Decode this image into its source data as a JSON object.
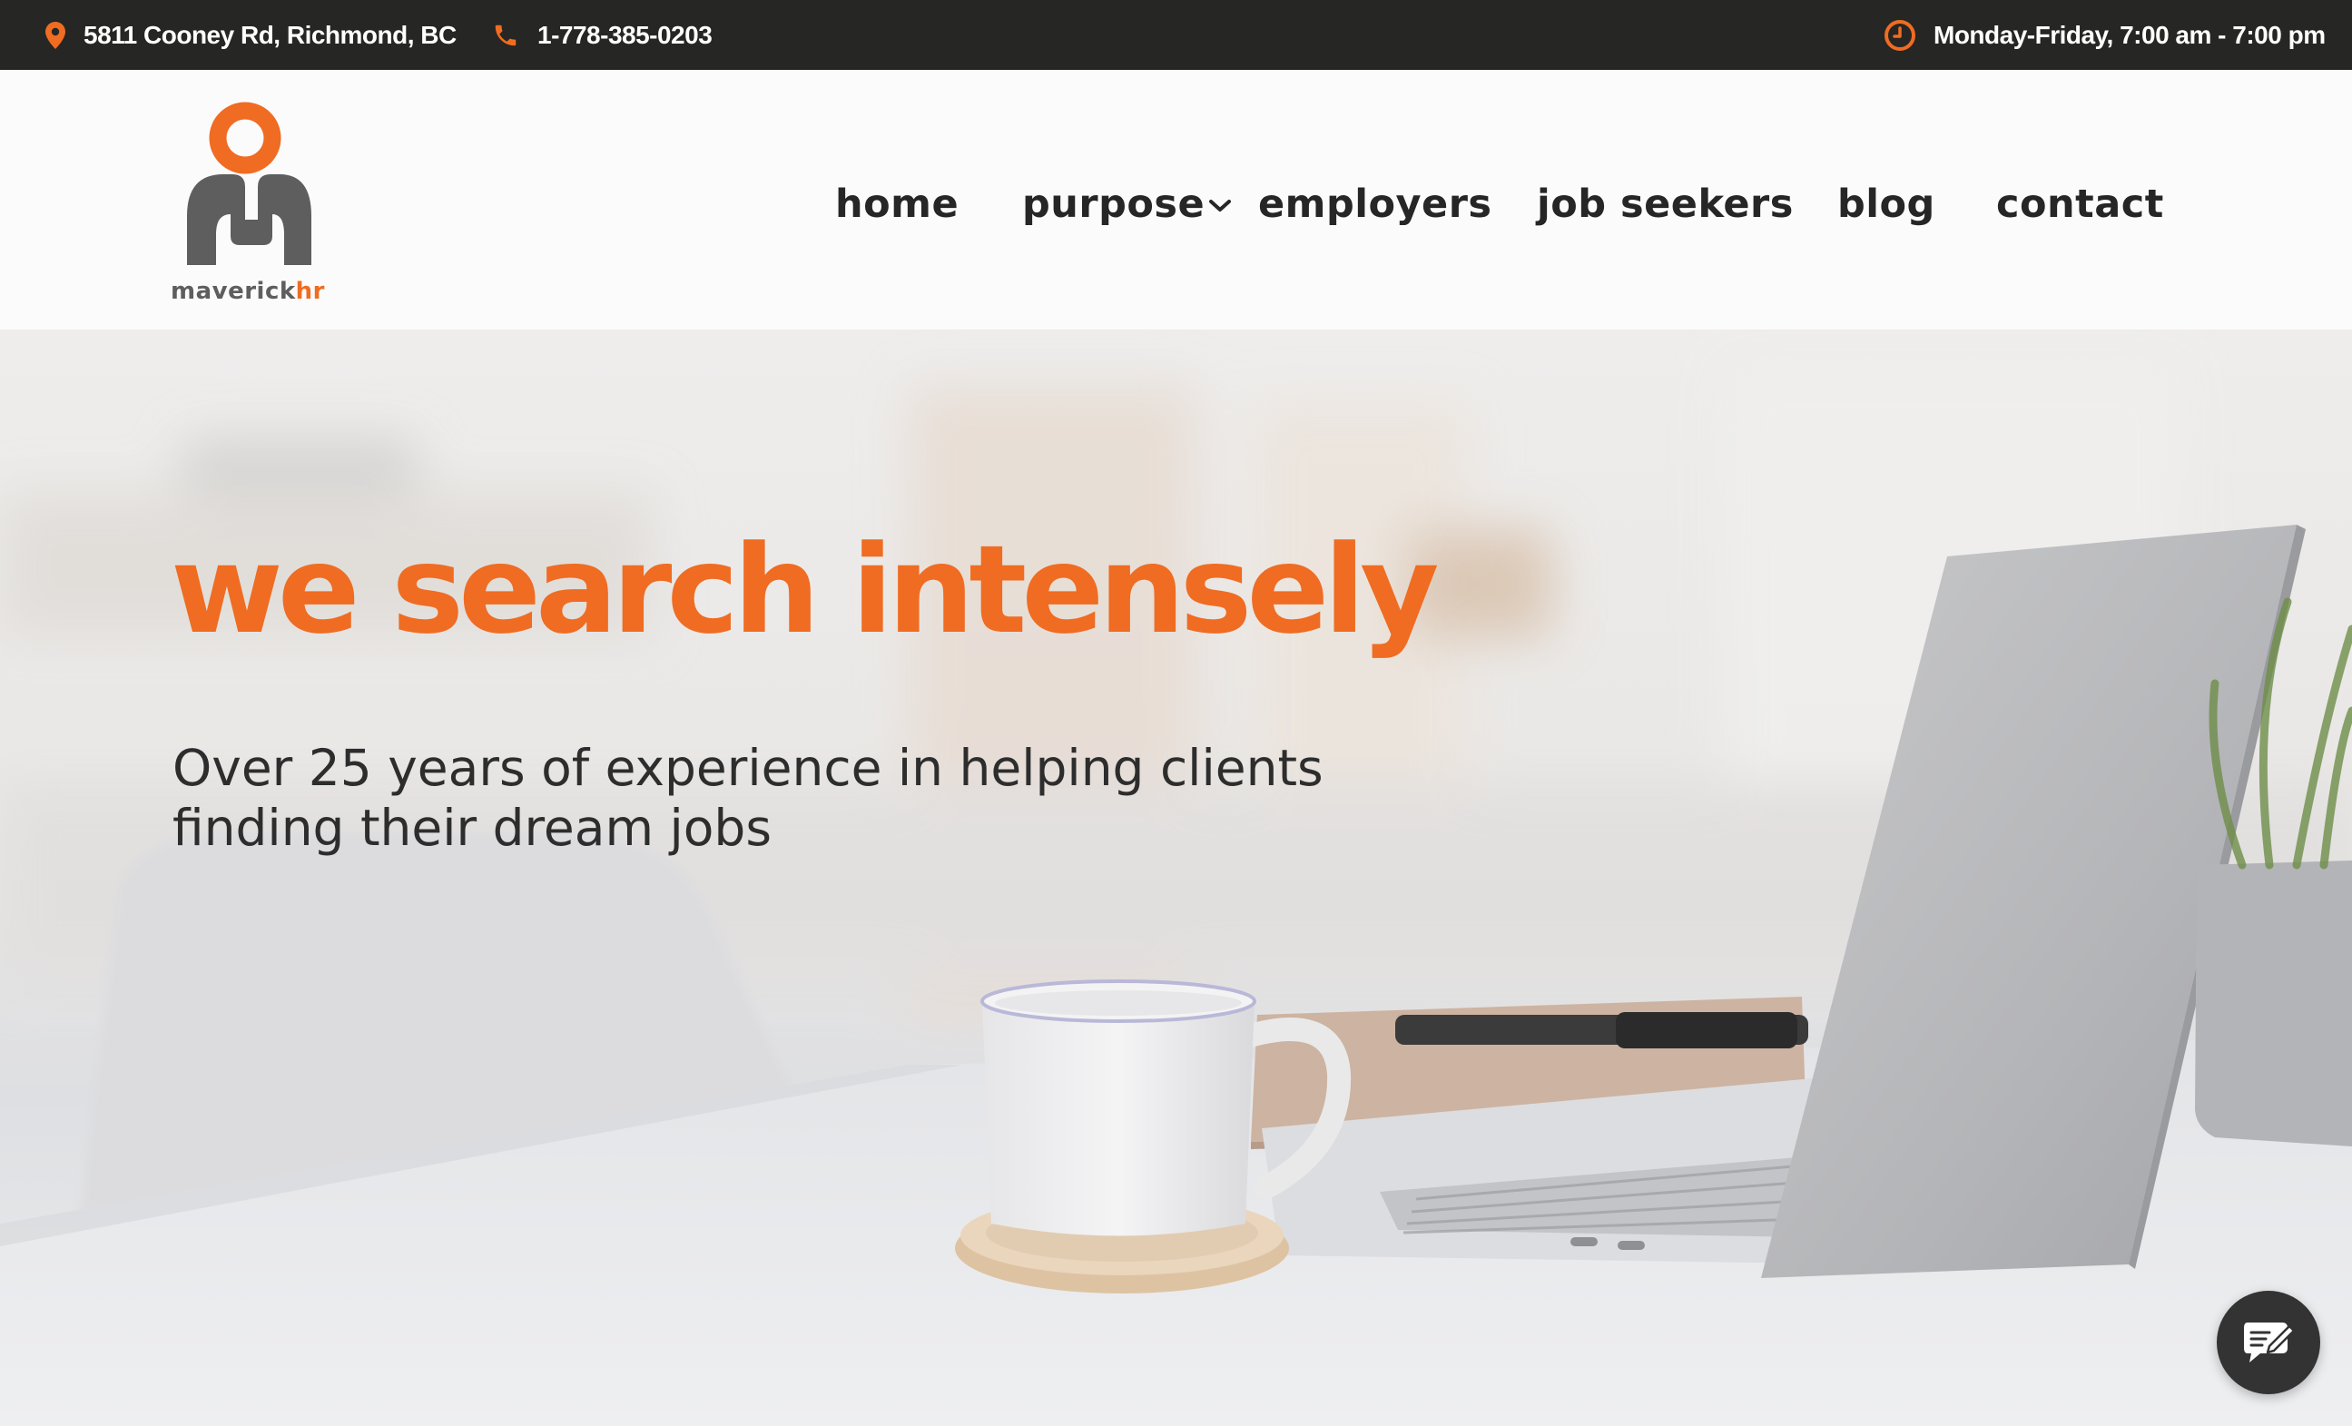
{
  "topbar": {
    "address": "5811 Cooney Rd, Richmond, BC",
    "address_icon": "map-pin-icon",
    "phone": "1-778-385-0203",
    "phone_icon": "phone-icon",
    "hours": "Monday-Friday, 7:00 am - 7:00 pm",
    "hours_icon": "clock-icon"
  },
  "logo": {
    "word_main": "maverick",
    "word_accent": "hr"
  },
  "nav": {
    "items": [
      {
        "label": "home"
      },
      {
        "label": "purpose",
        "has_dropdown": true
      },
      {
        "label": "employers"
      },
      {
        "label": "job seekers"
      },
      {
        "label": "blog"
      },
      {
        "label": "contact"
      }
    ]
  },
  "hero": {
    "title": "we search intensely",
    "subtitle": "Over 25 years of experience in helping clients finding their dream jobs"
  },
  "chat": {
    "icon": "compose-message-icon"
  },
  "colors": {
    "accent": "#ef6c22",
    "topbar_bg": "#262624",
    "header_bg": "#fbfbfb",
    "logo_gray": "#5e5e5e",
    "nav_text": "#262626",
    "chat_bg": "#333333"
  }
}
